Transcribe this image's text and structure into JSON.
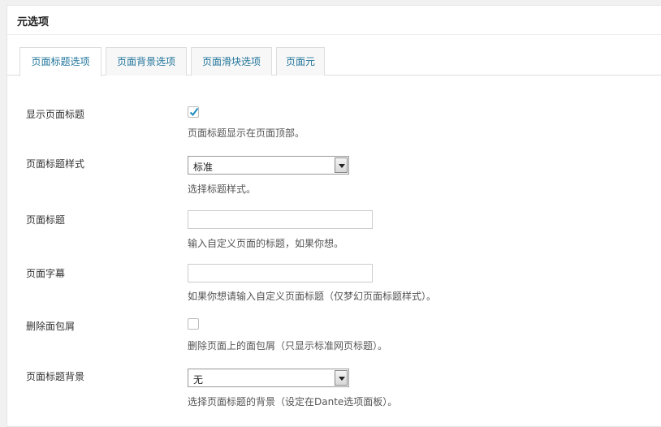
{
  "metabox": {
    "title": "元选项"
  },
  "tabs": [
    {
      "label": "页面标题选项",
      "active": true
    },
    {
      "label": "页面背景选项",
      "active": false
    },
    {
      "label": "页面滑块选项",
      "active": false
    },
    {
      "label": "页面元",
      "active": false
    }
  ],
  "options": {
    "show_title": {
      "label": "显示页面标题",
      "checked": true,
      "desc": "页面标题显示在页面顶部。"
    },
    "title_style": {
      "label": "页面标题样式",
      "value": "标准",
      "desc": "选择标题样式。"
    },
    "page_title": {
      "label": "页面标题",
      "value": "",
      "placeholder": "",
      "desc": "输入自定义页面的标题，如果你想。"
    },
    "subtitle": {
      "label": "页面字幕",
      "value": "",
      "placeholder": "",
      "desc": "如果你想请输入自定义页面标题（仅梦幻页面标题样式）。"
    },
    "remove_breadcrumb": {
      "label": "删除面包屑",
      "checked": false,
      "desc": "删除页面上的面包屑（只显示标准网页标题）。"
    },
    "title_bg": {
      "label": "页面标题背景",
      "value": "无",
      "desc": "选择页面标题的背景（设定在Dante选项面板）。"
    }
  },
  "colors": {
    "tab_text": "#21759b",
    "border": "#dddddd",
    "background": "#f1f1f1"
  }
}
